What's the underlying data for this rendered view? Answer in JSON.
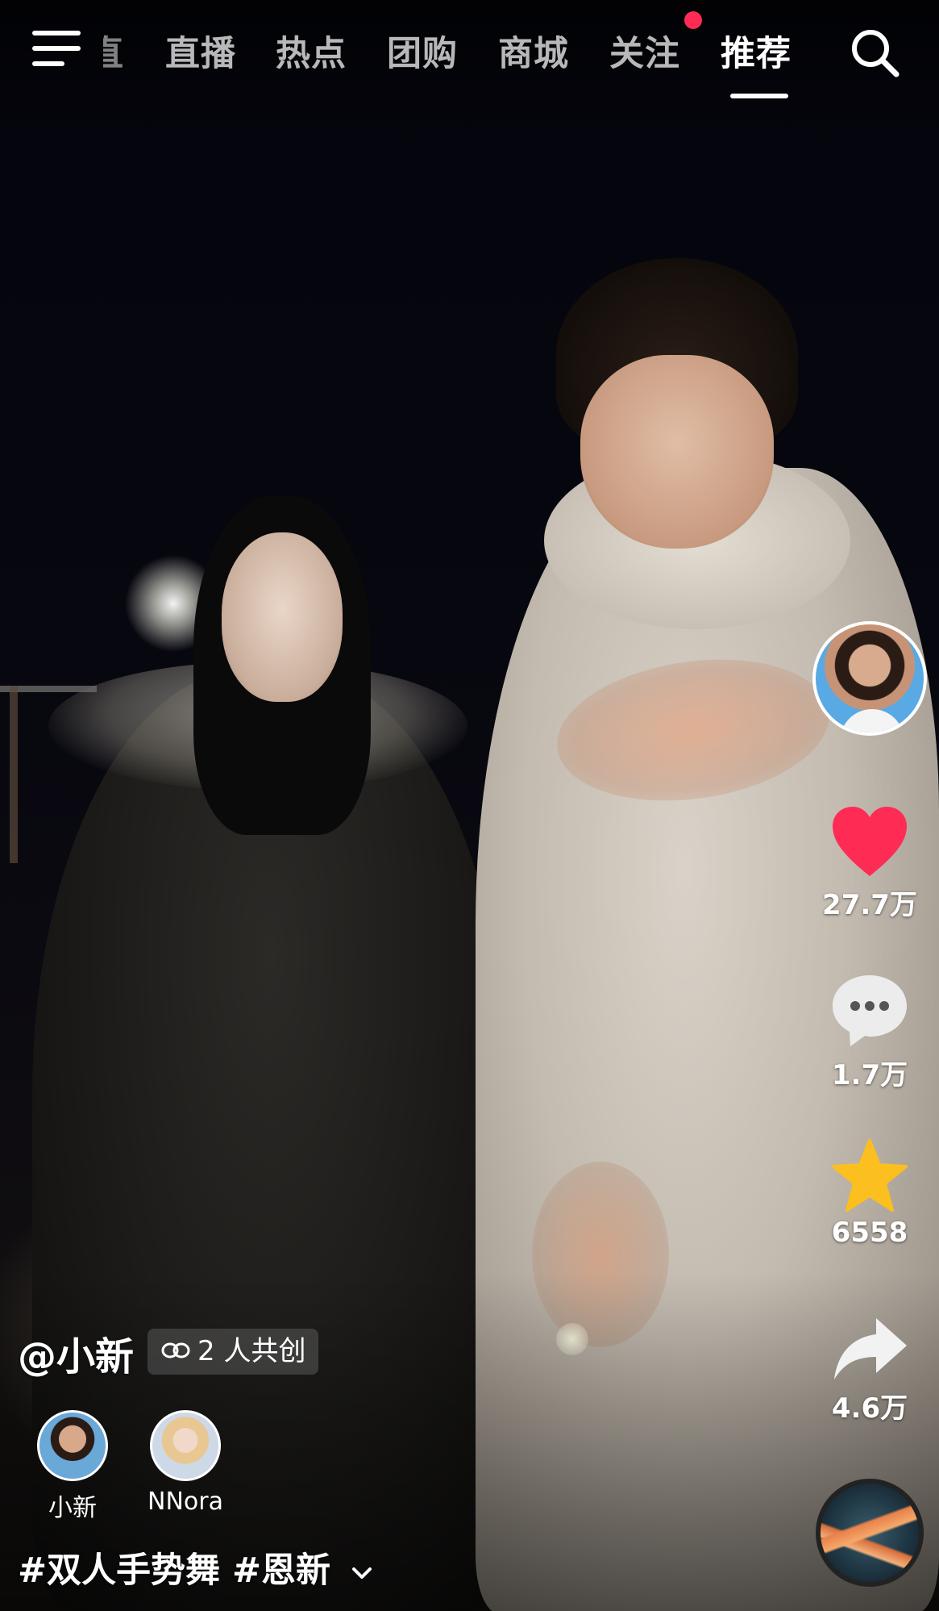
{
  "top_nav": {
    "partial_tab": "直",
    "tabs": [
      {
        "label": "直播",
        "active": false
      },
      {
        "label": "热点",
        "active": false
      },
      {
        "label": "团购",
        "active": false
      },
      {
        "label": "商城",
        "active": false
      },
      {
        "label": "关注",
        "active": false,
        "has_notification_dot": true
      },
      {
        "label": "推荐",
        "active": true
      }
    ],
    "menu_icon": "hamburger-menu-icon",
    "search_icon": "search-icon"
  },
  "actions": {
    "creator_avatar": "avatar",
    "like": {
      "icon": "heart-icon",
      "count": "27.7万",
      "color": "#fe2c55"
    },
    "comment": {
      "icon": "comment-bubble-icon",
      "count": "1.7万"
    },
    "favorite": {
      "icon": "star-icon",
      "count": "6558",
      "color": "#fbbf1f"
    },
    "share": {
      "icon": "share-arrow-icon",
      "count": "4.6万"
    },
    "music_disc": "music-disc"
  },
  "video_info": {
    "author": "@小新",
    "co_create_label": "2 人共创",
    "creators": [
      {
        "name": "小新"
      },
      {
        "name": "NNora"
      }
    ],
    "hashtags": [
      "#双人手势舞",
      "#恩新"
    ]
  },
  "colors": {
    "accent_red": "#fe2c55",
    "star_yellow": "#fbbf1f"
  }
}
